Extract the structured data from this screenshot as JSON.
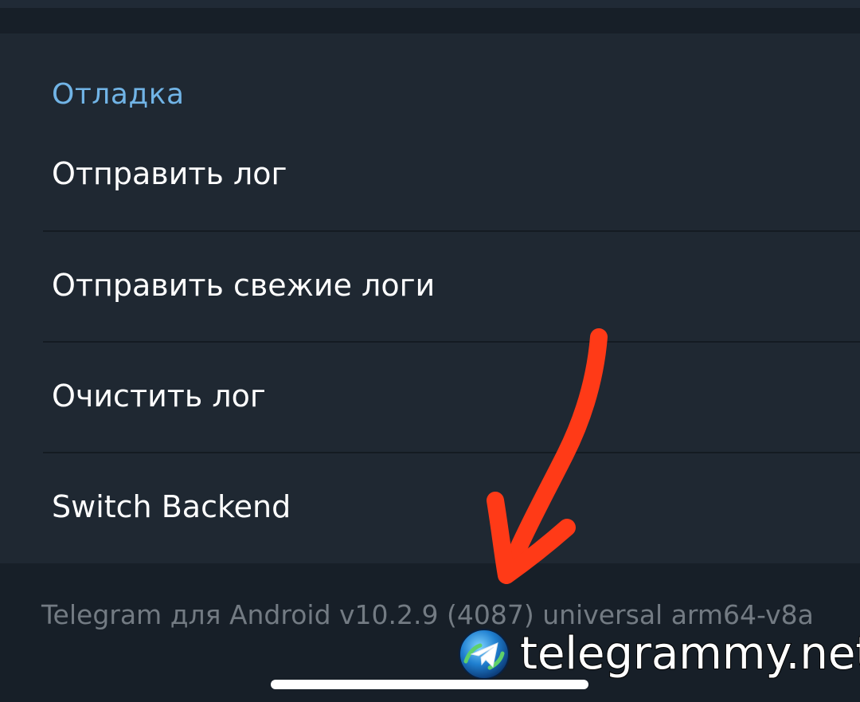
{
  "debug_section": {
    "header": "Отладка",
    "items": [
      {
        "label": "Отправить лог"
      },
      {
        "label": "Отправить свежие логи"
      },
      {
        "label": "Очистить лог"
      },
      {
        "label": "Switch Backend"
      }
    ]
  },
  "footer": {
    "version_text": "Telegram для Android v10.2.9 (4087) universal arm64-v8a"
  },
  "watermark": {
    "text": "telegrammy.net",
    "icon": "telegram-logo-icon"
  },
  "annotation": {
    "icon": "arrow-down-left-icon",
    "color": "#ff3a17"
  },
  "colors": {
    "background": "#171f28",
    "section_background": "#1f2832",
    "header_accent": "#71b4e6",
    "footer_text": "#737b83"
  }
}
